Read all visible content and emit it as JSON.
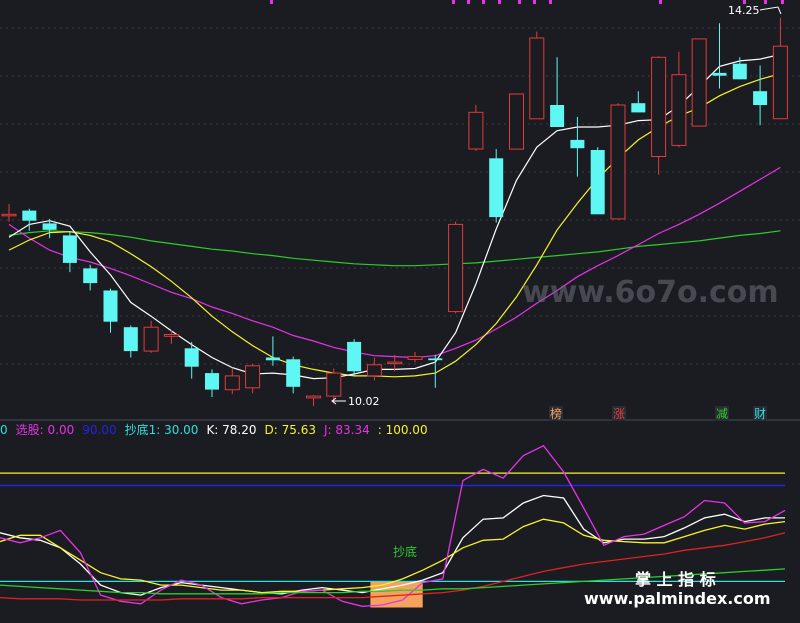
{
  "colors": {
    "background": "#1b1c21",
    "up_candle": "#e23b3b",
    "down_candle": "#5ff7f4",
    "ma_fast": "#ffffff",
    "ma_mid": "#f5f52a",
    "ma_slow": "#e533e6",
    "ma_long": "#2ccc2c",
    "k_line": "#ffffff",
    "d_line": "#f5f52a",
    "j_line": "#e533e6",
    "bottom_zone": "#f5a35c",
    "level_100": "#f5f52a",
    "level_blue": "#2323e6",
    "level_30": "#2ee0e0",
    "red_trend": "#dd2222",
    "green_trend": "#2ccc2c"
  },
  "chart_data": [
    {
      "type": "candlestick",
      "categories": [
        1,
        2,
        3,
        4,
        5,
        6,
        7,
        8,
        9,
        10,
        11,
        12,
        13,
        14,
        15,
        16,
        17,
        18,
        19,
        20,
        21,
        22,
        23,
        24,
        25,
        26,
        27,
        28,
        29,
        30,
        31,
        32,
        33,
        34,
        35,
        36,
        37,
        38,
        39
      ],
      "ohlc": [
        [
          12.1,
          12.22,
          12.03,
          12.11
        ],
        [
          12.15,
          12.17,
          11.93,
          12.04
        ],
        [
          12.01,
          12.06,
          11.85,
          11.94
        ],
        [
          11.88,
          11.92,
          11.48,
          11.58
        ],
        [
          11.52,
          11.56,
          11.28,
          11.36
        ],
        [
          11.28,
          11.3,
          10.82,
          10.94
        ],
        [
          10.88,
          10.9,
          10.55,
          10.62
        ],
        [
          10.62,
          10.95,
          10.6,
          10.88
        ],
        [
          10.78,
          10.85,
          10.7,
          10.8
        ],
        [
          10.65,
          10.72,
          10.32,
          10.45
        ],
        [
          10.38,
          10.42,
          10.12,
          10.2
        ],
        [
          10.2,
          10.44,
          10.15,
          10.35
        ],
        [
          10.22,
          10.48,
          10.16,
          10.46
        ],
        [
          10.55,
          10.78,
          10.46,
          10.52
        ],
        [
          10.53,
          10.56,
          10.16,
          10.23
        ],
        [
          10.11,
          10.14,
          10.02,
          10.13
        ],
        [
          10.13,
          10.43,
          10.05,
          10.38
        ],
        [
          10.72,
          10.75,
          10.35,
          10.4
        ],
        [
          10.35,
          10.55,
          10.3,
          10.47
        ],
        [
          10.49,
          10.58,
          10.4,
          10.5
        ],
        [
          10.53,
          10.61,
          10.5,
          10.56
        ],
        [
          10.54,
          10.58,
          10.22,
          10.52
        ],
        [
          11.05,
          12.03,
          11.03,
          12.0
        ],
        [
          12.82,
          13.3,
          12.8,
          13.22
        ],
        [
          12.72,
          12.82,
          12.02,
          12.08
        ],
        [
          12.82,
          13.42,
          12.82,
          13.42
        ],
        [
          13.15,
          14.1,
          13.15,
          14.03
        ],
        [
          13.3,
          13.82,
          13.06,
          13.06
        ],
        [
          12.92,
          13.17,
          12.52,
          12.83
        ],
        [
          12.81,
          12.84,
          12.13,
          12.11
        ],
        [
          12.06,
          13.32,
          12.05,
          13.3
        ],
        [
          13.32,
          13.45,
          13.22,
          13.22
        ],
        [
          12.74,
          13.83,
          12.54,
          13.82
        ],
        [
          12.86,
          13.88,
          12.84,
          13.63
        ],
        [
          13.07,
          14.02,
          13.07,
          14.02
        ],
        [
          13.65,
          14.19,
          13.48,
          13.62
        ],
        [
          13.75,
          13.82,
          13.58,
          13.58
        ],
        [
          13.45,
          13.73,
          13.08,
          13.3
        ],
        [
          13.15,
          14.25,
          13.15,
          13.94
        ]
      ],
      "ma_fast": [
        11.86,
        12.0,
        12.04,
        11.98,
        11.7,
        11.45,
        11.15,
        11.0,
        10.84,
        10.69,
        10.55,
        10.44,
        10.37,
        10.38,
        10.36,
        10.32,
        10.33,
        10.37,
        10.42,
        10.42,
        10.43,
        10.5,
        10.82,
        11.35,
        11.95,
        12.48,
        12.84,
        13.02,
        13.06,
        13.06,
        13.08,
        13.13,
        13.14,
        13.29,
        13.5,
        13.72,
        13.78,
        13.8,
        13.85
      ],
      "ma_mid": [
        11.72,
        11.83,
        11.91,
        11.92,
        11.88,
        11.81,
        11.68,
        11.54,
        11.38,
        11.2,
        11.0,
        10.83,
        10.68,
        10.55,
        10.47,
        10.42,
        10.38,
        10.35,
        10.35,
        10.34,
        10.35,
        10.38,
        10.51,
        10.69,
        10.92,
        11.21,
        11.56,
        11.94,
        12.23,
        12.5,
        12.72,
        12.92,
        13.06,
        13.18,
        13.27,
        13.4,
        13.5,
        13.58,
        13.64
      ],
      "ma_slow": [
        12.0,
        11.85,
        11.72,
        11.64,
        11.59,
        11.52,
        11.44,
        11.35,
        11.26,
        11.19,
        11.1,
        11.03,
        10.95,
        10.88,
        10.79,
        10.73,
        10.66,
        10.61,
        10.57,
        10.56,
        10.55,
        10.57,
        10.65,
        10.74,
        10.86,
        10.99,
        11.14,
        11.28,
        11.43,
        11.55,
        11.66,
        11.78,
        11.9,
        12.0,
        12.11,
        12.23,
        12.36,
        12.49,
        12.62
      ],
      "ma_long": [
        11.88,
        11.91,
        11.93,
        11.92,
        11.91,
        11.89,
        11.86,
        11.82,
        11.79,
        11.76,
        11.73,
        11.71,
        11.68,
        11.66,
        11.63,
        11.61,
        11.59,
        11.57,
        11.56,
        11.55,
        11.55,
        11.56,
        11.57,
        11.58,
        11.6,
        11.62,
        11.64,
        11.66,
        11.68,
        11.7,
        11.73,
        11.76,
        11.78,
        11.8,
        11.82,
        11.85,
        11.88,
        11.9,
        11.93
      ],
      "labels": {
        "high": "14.25",
        "low": "10.02"
      },
      "markers": [
        {
          "text": "榜",
          "color": "#f5a35c",
          "index": 28
        },
        {
          "text": "涨",
          "color": "#e23b3b",
          "index": 31
        },
        {
          "text": "减",
          "color": "#2ccc2c",
          "index": 36
        },
        {
          "text": "财",
          "color": "#2ee0e0",
          "index": 38
        }
      ],
      "watermark": "www.6o7o.com"
    },
    {
      "type": "line",
      "legend": [
        {
          "label": "0",
          "color": "#2ee0e0"
        },
        {
          "label": "选股: 0.00",
          "color": "#e533e6"
        },
        {
          "label": "90.00",
          "color": "#2323e6"
        },
        {
          "label": "抄底1: 30.00",
          "color": "#2ee0e0"
        },
        {
          "label": "K: 78.20",
          "color": "#ffffff"
        },
        {
          "label": "D: 75.63",
          "color": "#f5f52a"
        },
        {
          "label": "J: 83.34",
          "color": "#e533e6"
        },
        {
          "label": ": 100.00",
          "color": "#f5f52a"
        }
      ],
      "ylim": [
        0,
        120
      ],
      "levels": [
        100,
        90,
        30
      ],
      "x": [
        0,
        1,
        2,
        3,
        4,
        5,
        6,
        7,
        8,
        9,
        10,
        11,
        12,
        13,
        14,
        15,
        16,
        17,
        18,
        19,
        20,
        21,
        22,
        23,
        24,
        25,
        26,
        27,
        28,
        29,
        30,
        31,
        32,
        33,
        34,
        35,
        36,
        37,
        38,
        39
      ],
      "series": [
        {
          "name": "K",
          "values": [
            52,
            48,
            46,
            40,
            27,
            10,
            4,
            2,
            8,
            12,
            10,
            8,
            6,
            4,
            3,
            6,
            8,
            6,
            4,
            7,
            10,
            14,
            20,
            48,
            63,
            64,
            76,
            82,
            80,
            55,
            44,
            47,
            47,
            49,
            56,
            64,
            67,
            61,
            64,
            64
          ]
        },
        {
          "name": "D",
          "values": [
            45,
            50,
            50,
            40,
            30,
            20,
            15,
            14,
            10,
            10,
            8,
            6,
            6,
            4,
            5,
            5,
            6,
            7,
            8,
            10,
            15,
            22,
            30,
            40,
            46,
            47,
            57,
            63,
            60,
            50,
            46,
            45,
            44,
            44,
            49,
            54,
            58,
            55,
            59,
            61
          ]
        },
        {
          "name": "J",
          "values": [
            48,
            44,
            48,
            54,
            36,
            2,
            -3,
            -5,
            6,
            14,
            10,
            0,
            -5,
            -2,
            0,
            5,
            6,
            -3,
            -7,
            -6,
            -2,
            12,
            15,
            94,
            103,
            96,
            114,
            122,
            101,
            72,
            42,
            49,
            51,
            58,
            65,
            78,
            76,
            60,
            61,
            70
          ]
        },
        {
          "name": "red",
          "values": [
            0,
            -1,
            -1,
            -1,
            -2,
            -2,
            -2,
            -2,
            -2,
            -1,
            -1,
            -1,
            -1,
            0,
            0,
            0,
            0,
            0,
            0,
            1,
            2,
            3,
            4,
            6,
            9,
            13,
            17,
            21,
            24,
            27,
            29,
            31,
            33,
            35,
            38,
            40,
            42,
            45,
            48,
            52
          ]
        },
        {
          "name": "green",
          "values": [
            10,
            9,
            8,
            7,
            6,
            5,
            4,
            4,
            3,
            3,
            3,
            3,
            3,
            3,
            4,
            4,
            4,
            4,
            5,
            5,
            6,
            6,
            7,
            7,
            8,
            9,
            10,
            11,
            12,
            13,
            14,
            15,
            16,
            17,
            18,
            19,
            20,
            21,
            22,
            23
          ]
        }
      ],
      "bottom_zone": {
        "start_index": 21,
        "end_index": 23,
        "label": "抄底"
      },
      "watermark_cn": "掌 上 指 标",
      "watermark_url": "www.palmindex.com"
    }
  ]
}
